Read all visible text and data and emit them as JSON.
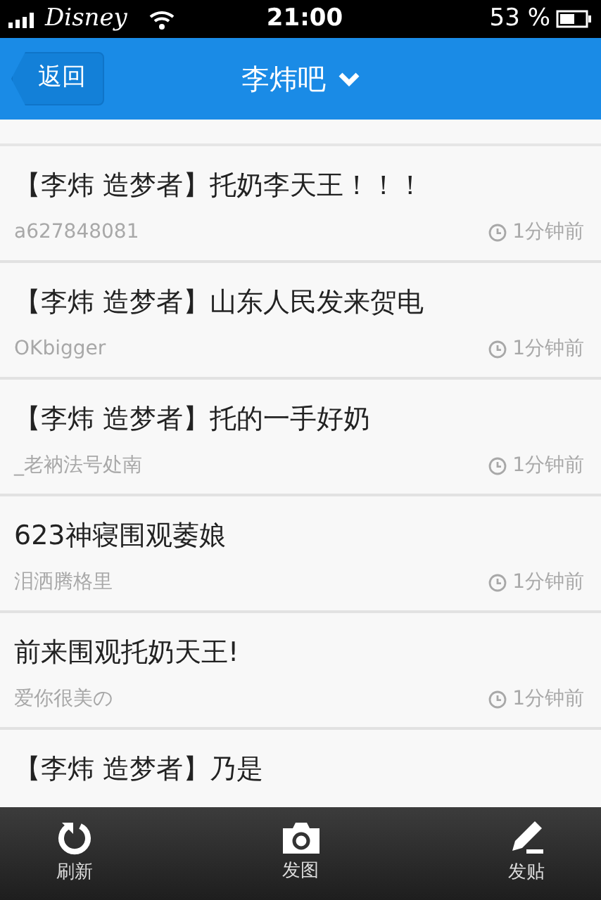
{
  "status_bar": {
    "carrier": "Disney",
    "time": "21:00",
    "battery": "53 %"
  },
  "nav": {
    "back": "返回",
    "title": "李炜吧"
  },
  "posts": [
    {
      "title": "【李炜 造梦者】托奶李天王！！！",
      "author": "a627848081",
      "time": "1分钟前"
    },
    {
      "title": "【李炜 造梦者】山东人民发来贺电",
      "author": "OKbigger",
      "time": "1分钟前"
    },
    {
      "title": "【李炜 造梦者】托的一手好奶",
      "author": "_老衲法号处南",
      "time": "1分钟前"
    },
    {
      "title": "623神寝围观萎娘",
      "author": "泪洒腾格里",
      "time": "1分钟前"
    },
    {
      "title": "前来围观托奶天王!",
      "author": "爱你很美の",
      "time": "1分钟前"
    },
    {
      "title": "【李炜 造梦者】乃是"
    }
  ],
  "toolbar": [
    {
      "kind": "refresh",
      "label": "刷新"
    },
    {
      "kind": "camera",
      "label": "发图"
    },
    {
      "kind": "compose",
      "label": "发贴"
    }
  ]
}
